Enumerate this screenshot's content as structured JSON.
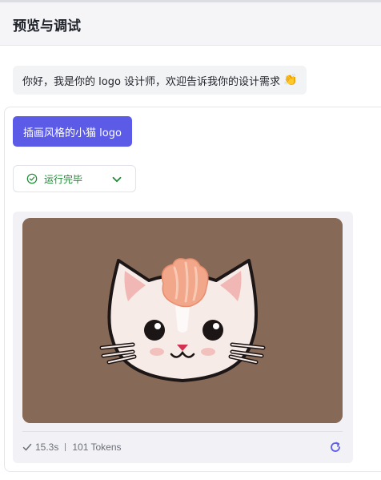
{
  "header": {
    "title": "预览与调试"
  },
  "chat": {
    "greeting": "你好，我是你的 logo 设计师，欢迎告诉我你的设计需求",
    "greeting_emoji": "👏",
    "user_message": "插画风格的小猫 logo",
    "status": {
      "label": "运行完毕",
      "icon": "check-circle-icon",
      "color": "#1f8a35"
    },
    "result": {
      "image_subject": "cat-logo-illustration",
      "duration": "15.3s",
      "tokens": "101 Tokens"
    }
  },
  "colors": {
    "accent": "#5b5be8",
    "image_background": "#876957",
    "success": "#1f8a35"
  }
}
